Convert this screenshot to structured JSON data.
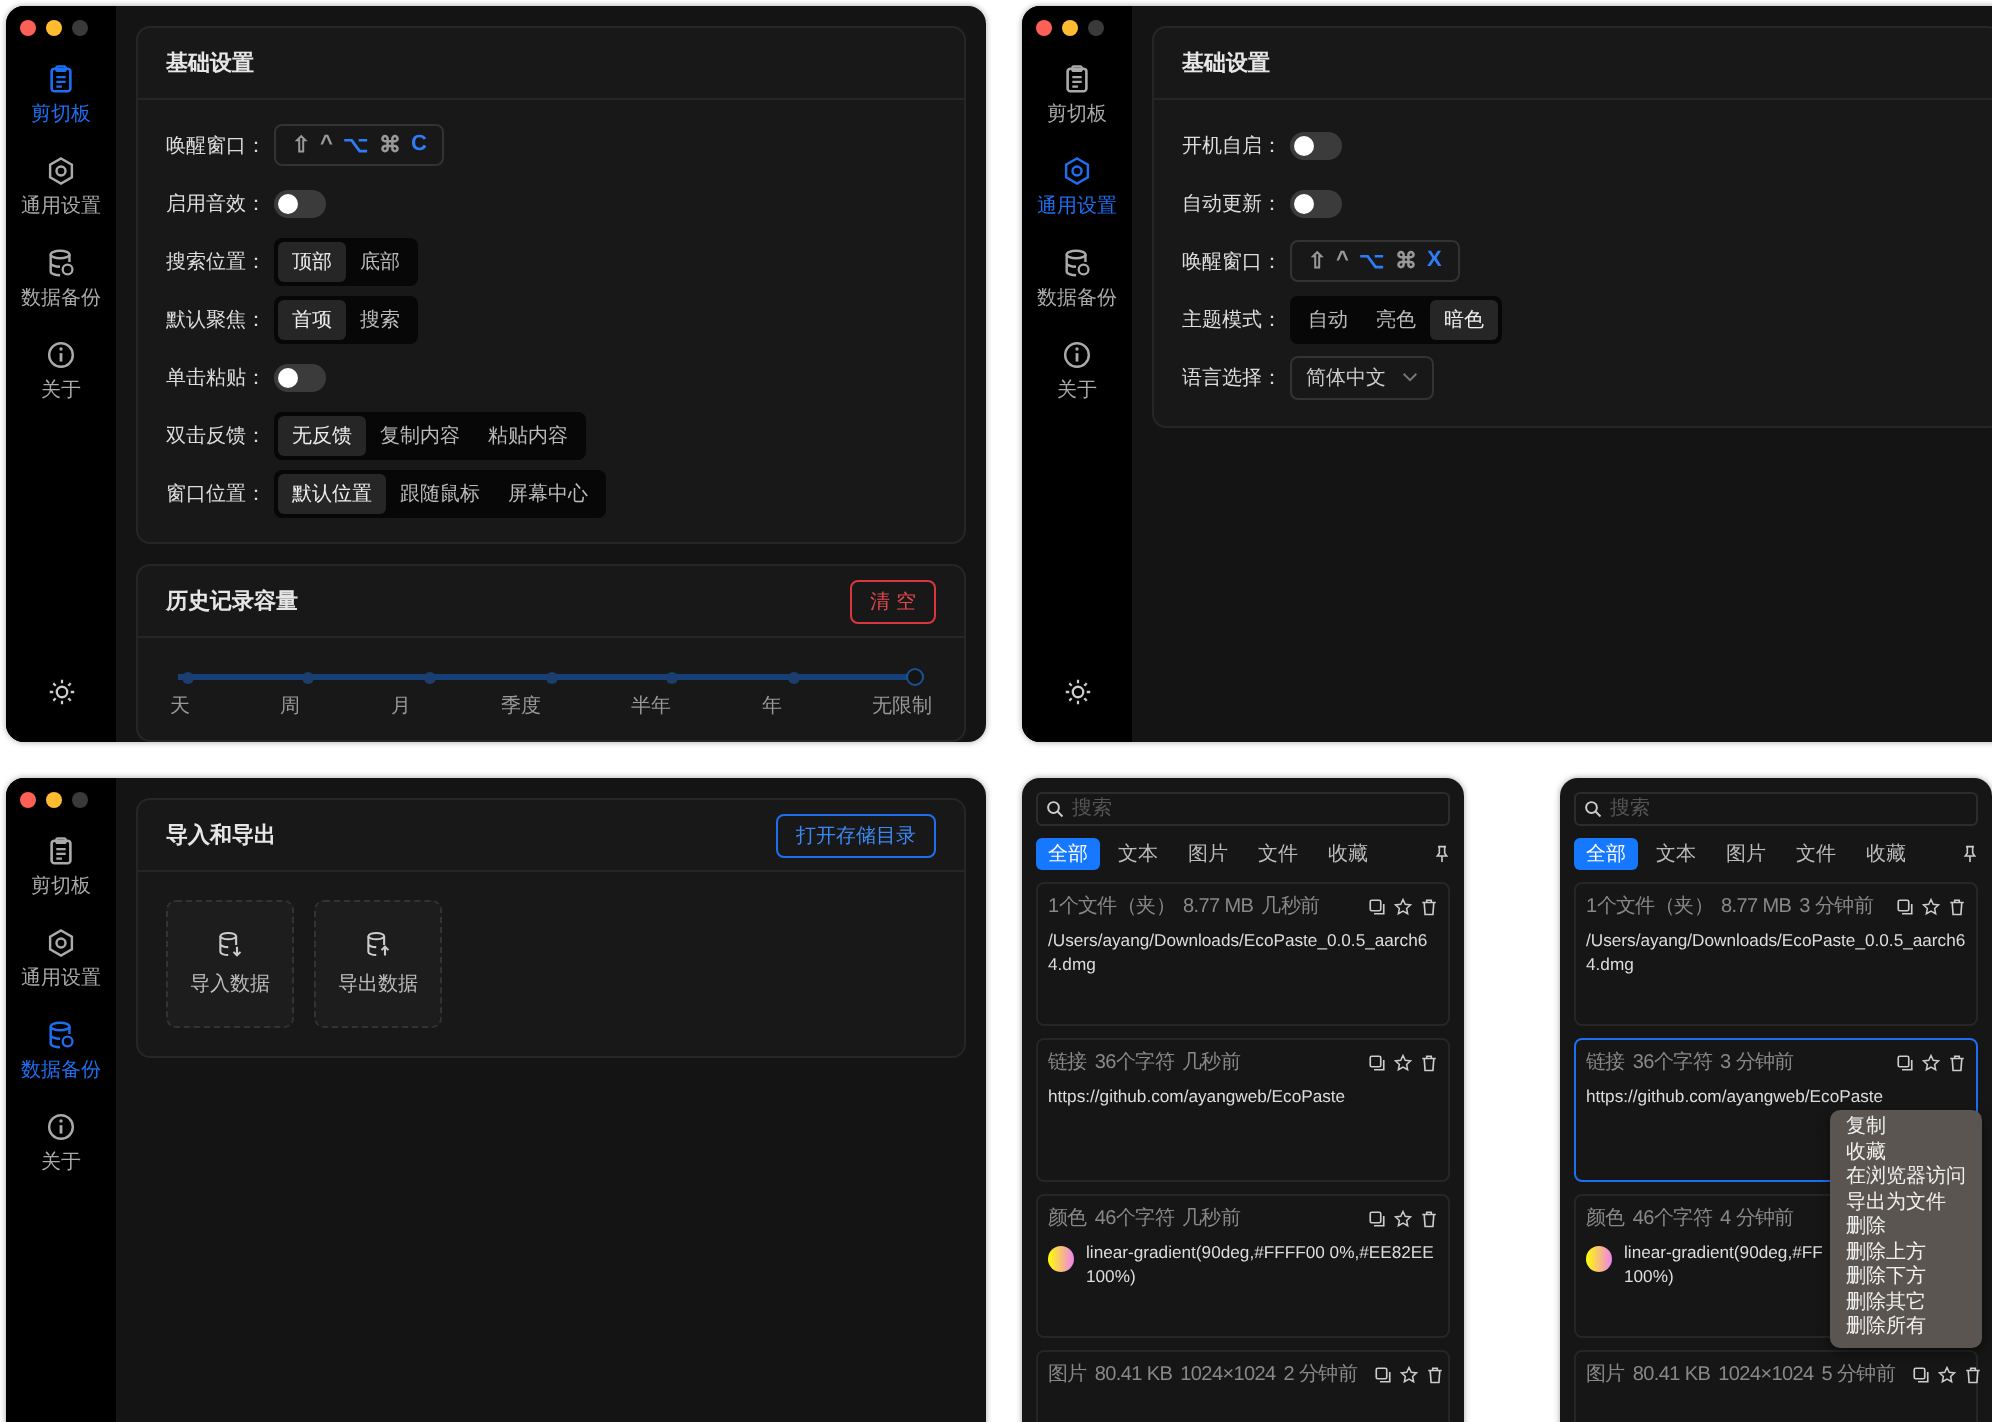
{
  "windows": [
    {
      "kind": "settings",
      "sidebar": [
        {
          "label": "剪切板",
          "selected": true
        },
        {
          "label": "通用设置",
          "selected": false
        },
        {
          "label": "数据备份",
          "selected": false
        },
        {
          "label": "关于",
          "selected": false
        }
      ],
      "cards": [
        {
          "title": "基础设置",
          "rows": [
            {
              "kind": "shortcut",
              "label": "唤醒窗口：",
              "keys": [
                {
                  "key": "⇧",
                  "on": false
                },
                {
                  "key": "^",
                  "on": false
                },
                {
                  "key": "⌥",
                  "on": true
                },
                {
                  "key": "⌘",
                  "on": false
                },
                {
                  "key": "C",
                  "on": true
                }
              ]
            },
            {
              "kind": "switch",
              "label": "启用音效：",
              "on": false
            },
            {
              "kind": "segmented",
              "label": "搜索位置：",
              "options": [
                {
                  "label": "顶部",
                  "selected": true
                },
                {
                  "label": "底部",
                  "selected": false
                }
              ]
            },
            {
              "kind": "segmented",
              "label": "默认聚焦：",
              "options": [
                {
                  "label": "首项",
                  "selected": true
                },
                {
                  "label": "搜索",
                  "selected": false
                }
              ]
            },
            {
              "kind": "switch",
              "label": "单击粘贴：",
              "on": false
            },
            {
              "kind": "segmented",
              "label": "双击反馈：",
              "options": [
                {
                  "label": "无反馈",
                  "selected": true
                },
                {
                  "label": "复制内容",
                  "selected": false
                },
                {
                  "label": "粘贴内容",
                  "selected": false
                }
              ]
            },
            {
              "kind": "segmented",
              "label": "窗口位置：",
              "options": [
                {
                  "label": "默认位置",
                  "selected": true
                },
                {
                  "label": "跟随鼠标",
                  "selected": false
                },
                {
                  "label": "屏幕中心",
                  "selected": false
                }
              ]
            }
          ]
        },
        {
          "title": "历史记录容量",
          "button": {
            "label": "清 空",
            "kind": "danger"
          },
          "slider": {
            "level": 1,
            "labels": [
              "天",
              "周",
              "月",
              "季度",
              "半年",
              "年",
              "无限制"
            ]
          }
        }
      ]
    },
    {
      "kind": "settings",
      "sidebar": [
        {
          "label": "剪切板",
          "selected": false
        },
        {
          "label": "通用设置",
          "selected": true
        },
        {
          "label": "数据备份",
          "selected": false
        },
        {
          "label": "关于",
          "selected": false
        }
      ],
      "cards": [
        {
          "title": "基础设置",
          "rows": [
            {
              "kind": "switch",
              "label": "开机自启：",
              "on": false
            },
            {
              "kind": "switch",
              "label": "自动更新：",
              "on": false
            },
            {
              "kind": "shortcut",
              "label": "唤醒窗口：",
              "keys": [
                {
                  "key": "⇧",
                  "on": false
                },
                {
                  "key": "^",
                  "on": false
                },
                {
                  "key": "⌥",
                  "on": true
                },
                {
                  "key": "⌘",
                  "on": false
                },
                {
                  "key": "X",
                  "on": true
                }
              ]
            },
            {
              "kind": "segmented",
              "label": "主题模式：",
              "options": [
                {
                  "label": "自动",
                  "selected": false
                },
                {
                  "label": "亮色",
                  "selected": false
                },
                {
                  "label": "暗色",
                  "selected": true
                }
              ]
            },
            {
              "kind": "select",
              "label": "语言选择：",
              "value": "简体中文"
            }
          ]
        }
      ]
    },
    {
      "kind": "settings",
      "sidebar": [
        {
          "label": "剪切板",
          "selected": false
        },
        {
          "label": "通用设置",
          "selected": false
        },
        {
          "label": "数据备份",
          "selected": true
        },
        {
          "label": "关于",
          "selected": false
        }
      ],
      "cards": [
        {
          "title": "导入和导出",
          "button": {
            "label": "打开存储目录",
            "kind": "primary"
          },
          "tiles": [
            {
              "label": "导入数据",
              "kind": "import"
            },
            {
              "label": "导出数据",
              "kind": "export"
            }
          ]
        }
      ]
    },
    {
      "kind": "clipboard",
      "search": {
        "placeholder": "搜索"
      },
      "tabs": [
        {
          "label": "全部",
          "selected": true
        },
        {
          "label": "文本",
          "selected": false
        },
        {
          "label": "图片",
          "selected": false
        },
        {
          "label": "文件",
          "selected": false
        },
        {
          "label": "收藏",
          "selected": false
        }
      ],
      "items": [
        {
          "kind": "file",
          "selected": false,
          "meta": [
            "1个文件（夹）",
            "8.77 MB",
            "几秒前"
          ],
          "text": "/Users/ayang/Downloads/EcoPaste_0.0.5_aarch64.dmg"
        },
        {
          "kind": "link",
          "selected": false,
          "meta": [
            "链接",
            "36个字符",
            "几秒前"
          ],
          "text": "https://github.com/ayangweb/EcoPaste"
        },
        {
          "kind": "color",
          "selected": false,
          "meta": [
            "颜色",
            "46个字符",
            "几秒前"
          ],
          "lines": [
            "linear-gradient(90deg,#FFFF00 0%,#EE82EE",
            "100%)"
          ]
        },
        {
          "kind": "image",
          "selected": false,
          "meta": [
            "图片",
            "80.41 KB",
            "1024×1024",
            "2 分钟前"
          ]
        }
      ]
    },
    {
      "kind": "clipboard",
      "search": {
        "placeholder": "搜索"
      },
      "tabs": [
        {
          "label": "全部",
          "selected": true
        },
        {
          "label": "文本",
          "selected": false
        },
        {
          "label": "图片",
          "selected": false
        },
        {
          "label": "文件",
          "selected": false
        },
        {
          "label": "收藏",
          "selected": false
        }
      ],
      "items": [
        {
          "kind": "file",
          "selected": false,
          "meta": [
            "1个文件（夹）",
            "8.77 MB",
            "3 分钟前"
          ],
          "text": "/Users/ayang/Downloads/EcoPaste_0.0.5_aarch64.dmg"
        },
        {
          "kind": "link",
          "selected": true,
          "meta": [
            "链接",
            "36个字符",
            "3 分钟前"
          ],
          "text": "https://github.com/ayangweb/EcoPaste"
        },
        {
          "kind": "color",
          "selected": false,
          "meta": [
            "颜色",
            "46个字符",
            "4 分钟前"
          ],
          "lines": [
            "linear-gradient(90deg,#FF",
            "100%)"
          ]
        },
        {
          "kind": "image",
          "selected": false,
          "meta": [
            "图片",
            "80.41 KB",
            "1024×1024",
            "5 分钟前"
          ]
        }
      ],
      "menu": [
        "复制",
        "收藏",
        "在浏览器访问",
        "导出为文件",
        "删除",
        "删除上方",
        "删除下方",
        "删除其它",
        "删除所有"
      ]
    }
  ]
}
